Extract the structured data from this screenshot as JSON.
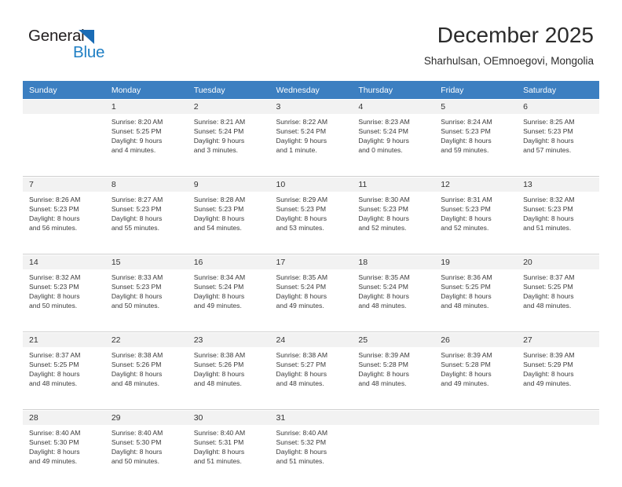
{
  "brand": {
    "name_top": "General",
    "name_bottom": "Blue",
    "accent_color": "#1f7fc4",
    "triangle_color": "#1a6cb5"
  },
  "header": {
    "title": "December 2025",
    "subtitle": "Sharhulsan, OEmnoegovi, Mongolia"
  },
  "calendar": {
    "header_bg": "#3c7fc1",
    "daynum_bg": "#f2f2f2",
    "weekdays": [
      "Sunday",
      "Monday",
      "Tuesday",
      "Wednesday",
      "Thursday",
      "Friday",
      "Saturday"
    ],
    "weeks": [
      [
        {
          "day": "",
          "sunrise": "",
          "sunset": "",
          "daylight_line1": "",
          "daylight_line2": ""
        },
        {
          "day": "1",
          "sunrise": "Sunrise: 8:20 AM",
          "sunset": "Sunset: 5:25 PM",
          "daylight_line1": "Daylight: 9 hours",
          "daylight_line2": "and 4 minutes."
        },
        {
          "day": "2",
          "sunrise": "Sunrise: 8:21 AM",
          "sunset": "Sunset: 5:24 PM",
          "daylight_line1": "Daylight: 9 hours",
          "daylight_line2": "and 3 minutes."
        },
        {
          "day": "3",
          "sunrise": "Sunrise: 8:22 AM",
          "sunset": "Sunset: 5:24 PM",
          "daylight_line1": "Daylight: 9 hours",
          "daylight_line2": "and 1 minute."
        },
        {
          "day": "4",
          "sunrise": "Sunrise: 8:23 AM",
          "sunset": "Sunset: 5:24 PM",
          "daylight_line1": "Daylight: 9 hours",
          "daylight_line2": "and 0 minutes."
        },
        {
          "day": "5",
          "sunrise": "Sunrise: 8:24 AM",
          "sunset": "Sunset: 5:23 PM",
          "daylight_line1": "Daylight: 8 hours",
          "daylight_line2": "and 59 minutes."
        },
        {
          "day": "6",
          "sunrise": "Sunrise: 8:25 AM",
          "sunset": "Sunset: 5:23 PM",
          "daylight_line1": "Daylight: 8 hours",
          "daylight_line2": "and 57 minutes."
        }
      ],
      [
        {
          "day": "7",
          "sunrise": "Sunrise: 8:26 AM",
          "sunset": "Sunset: 5:23 PM",
          "daylight_line1": "Daylight: 8 hours",
          "daylight_line2": "and 56 minutes."
        },
        {
          "day": "8",
          "sunrise": "Sunrise: 8:27 AM",
          "sunset": "Sunset: 5:23 PM",
          "daylight_line1": "Daylight: 8 hours",
          "daylight_line2": "and 55 minutes."
        },
        {
          "day": "9",
          "sunrise": "Sunrise: 8:28 AM",
          "sunset": "Sunset: 5:23 PM",
          "daylight_line1": "Daylight: 8 hours",
          "daylight_line2": "and 54 minutes."
        },
        {
          "day": "10",
          "sunrise": "Sunrise: 8:29 AM",
          "sunset": "Sunset: 5:23 PM",
          "daylight_line1": "Daylight: 8 hours",
          "daylight_line2": "and 53 minutes."
        },
        {
          "day": "11",
          "sunrise": "Sunrise: 8:30 AM",
          "sunset": "Sunset: 5:23 PM",
          "daylight_line1": "Daylight: 8 hours",
          "daylight_line2": "and 52 minutes."
        },
        {
          "day": "12",
          "sunrise": "Sunrise: 8:31 AM",
          "sunset": "Sunset: 5:23 PM",
          "daylight_line1": "Daylight: 8 hours",
          "daylight_line2": "and 52 minutes."
        },
        {
          "day": "13",
          "sunrise": "Sunrise: 8:32 AM",
          "sunset": "Sunset: 5:23 PM",
          "daylight_line1": "Daylight: 8 hours",
          "daylight_line2": "and 51 minutes."
        }
      ],
      [
        {
          "day": "14",
          "sunrise": "Sunrise: 8:32 AM",
          "sunset": "Sunset: 5:23 PM",
          "daylight_line1": "Daylight: 8 hours",
          "daylight_line2": "and 50 minutes."
        },
        {
          "day": "15",
          "sunrise": "Sunrise: 8:33 AM",
          "sunset": "Sunset: 5:23 PM",
          "daylight_line1": "Daylight: 8 hours",
          "daylight_line2": "and 50 minutes."
        },
        {
          "day": "16",
          "sunrise": "Sunrise: 8:34 AM",
          "sunset": "Sunset: 5:24 PM",
          "daylight_line1": "Daylight: 8 hours",
          "daylight_line2": "and 49 minutes."
        },
        {
          "day": "17",
          "sunrise": "Sunrise: 8:35 AM",
          "sunset": "Sunset: 5:24 PM",
          "daylight_line1": "Daylight: 8 hours",
          "daylight_line2": "and 49 minutes."
        },
        {
          "day": "18",
          "sunrise": "Sunrise: 8:35 AM",
          "sunset": "Sunset: 5:24 PM",
          "daylight_line1": "Daylight: 8 hours",
          "daylight_line2": "and 48 minutes."
        },
        {
          "day": "19",
          "sunrise": "Sunrise: 8:36 AM",
          "sunset": "Sunset: 5:25 PM",
          "daylight_line1": "Daylight: 8 hours",
          "daylight_line2": "and 48 minutes."
        },
        {
          "day": "20",
          "sunrise": "Sunrise: 8:37 AM",
          "sunset": "Sunset: 5:25 PM",
          "daylight_line1": "Daylight: 8 hours",
          "daylight_line2": "and 48 minutes."
        }
      ],
      [
        {
          "day": "21",
          "sunrise": "Sunrise: 8:37 AM",
          "sunset": "Sunset: 5:25 PM",
          "daylight_line1": "Daylight: 8 hours",
          "daylight_line2": "and 48 minutes."
        },
        {
          "day": "22",
          "sunrise": "Sunrise: 8:38 AM",
          "sunset": "Sunset: 5:26 PM",
          "daylight_line1": "Daylight: 8 hours",
          "daylight_line2": "and 48 minutes."
        },
        {
          "day": "23",
          "sunrise": "Sunrise: 8:38 AM",
          "sunset": "Sunset: 5:26 PM",
          "daylight_line1": "Daylight: 8 hours",
          "daylight_line2": "and 48 minutes."
        },
        {
          "day": "24",
          "sunrise": "Sunrise: 8:38 AM",
          "sunset": "Sunset: 5:27 PM",
          "daylight_line1": "Daylight: 8 hours",
          "daylight_line2": "and 48 minutes."
        },
        {
          "day": "25",
          "sunrise": "Sunrise: 8:39 AM",
          "sunset": "Sunset: 5:28 PM",
          "daylight_line1": "Daylight: 8 hours",
          "daylight_line2": "and 48 minutes."
        },
        {
          "day": "26",
          "sunrise": "Sunrise: 8:39 AM",
          "sunset": "Sunset: 5:28 PM",
          "daylight_line1": "Daylight: 8 hours",
          "daylight_line2": "and 49 minutes."
        },
        {
          "day": "27",
          "sunrise": "Sunrise: 8:39 AM",
          "sunset": "Sunset: 5:29 PM",
          "daylight_line1": "Daylight: 8 hours",
          "daylight_line2": "and 49 minutes."
        }
      ],
      [
        {
          "day": "28",
          "sunrise": "Sunrise: 8:40 AM",
          "sunset": "Sunset: 5:30 PM",
          "daylight_line1": "Daylight: 8 hours",
          "daylight_line2": "and 49 minutes."
        },
        {
          "day": "29",
          "sunrise": "Sunrise: 8:40 AM",
          "sunset": "Sunset: 5:30 PM",
          "daylight_line1": "Daylight: 8 hours",
          "daylight_line2": "and 50 minutes."
        },
        {
          "day": "30",
          "sunrise": "Sunrise: 8:40 AM",
          "sunset": "Sunset: 5:31 PM",
          "daylight_line1": "Daylight: 8 hours",
          "daylight_line2": "and 51 minutes."
        },
        {
          "day": "31",
          "sunrise": "Sunrise: 8:40 AM",
          "sunset": "Sunset: 5:32 PM",
          "daylight_line1": "Daylight: 8 hours",
          "daylight_line2": "and 51 minutes."
        },
        {
          "day": "",
          "sunrise": "",
          "sunset": "",
          "daylight_line1": "",
          "daylight_line2": ""
        },
        {
          "day": "",
          "sunrise": "",
          "sunset": "",
          "daylight_line1": "",
          "daylight_line2": ""
        },
        {
          "day": "",
          "sunrise": "",
          "sunset": "",
          "daylight_line1": "",
          "daylight_line2": ""
        }
      ]
    ]
  }
}
